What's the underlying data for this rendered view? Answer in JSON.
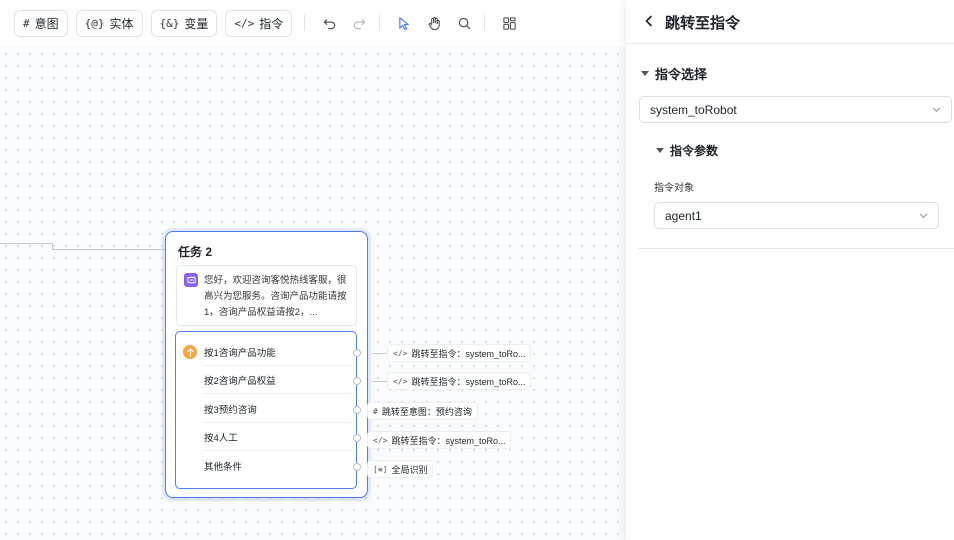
{
  "toolbar": {
    "buttons": [
      {
        "icon": "#",
        "label": "意图"
      },
      {
        "icon": "{@}",
        "label": "实体"
      },
      {
        "icon": "{&}",
        "label": "变量"
      },
      {
        "icon": "</>",
        "label": "指令"
      }
    ]
  },
  "task_node": {
    "title": "任务 2",
    "message": "您好，欢迎咨询客悦热线客服，很高兴为您服务。咨询产品功能请按1，咨询产品权益请按2，...",
    "conditions": [
      {
        "label": "按1咨询产品功能"
      },
      {
        "label": "按2咨询产品权益"
      },
      {
        "label": "按3预约咨询"
      },
      {
        "label": "按4人工"
      },
      {
        "label": "其他条件"
      }
    ]
  },
  "targets": [
    {
      "icon": "</>",
      "label": "跳转至指令：system_toRo..."
    },
    {
      "icon": "</>",
      "label": "跳转至指令：system_toRo..."
    },
    {
      "icon": "#",
      "label": "跳转至意图：预约咨询"
    },
    {
      "icon": "</>",
      "label": "跳转至指令：system_toRo..."
    },
    {
      "icon": "[≡]",
      "label": "全局识别"
    }
  ],
  "panel": {
    "title": "跳转至指令",
    "section_title": "指令选择",
    "command_value": "system_toRobot",
    "sub_section_title": "指令参数",
    "param_label": "指令对象",
    "param_value": "agent1"
  },
  "colors": {
    "accent": "#4d7cfe",
    "message_icon": "#8b63e8",
    "condition_icon": "#f7a541"
  }
}
